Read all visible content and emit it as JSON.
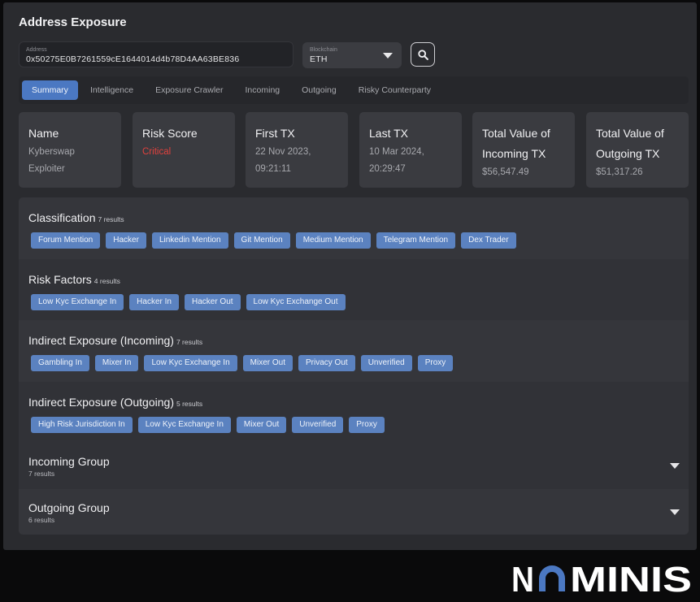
{
  "header": {
    "title": "Address Exposure"
  },
  "address_field": {
    "label": "Address",
    "value": "0x50275E0B7261559cE1644014d4b78D4AA63BE836"
  },
  "blockchain_select": {
    "label": "Blockchain",
    "value": "ETH"
  },
  "tabs": [
    {
      "label": "Summary",
      "active": true
    },
    {
      "label": "Intelligence"
    },
    {
      "label": "Exposure Crawler"
    },
    {
      "label": "Incoming"
    },
    {
      "label": "Outgoing"
    },
    {
      "label": "Risky Counterparty"
    }
  ],
  "cards": {
    "name": {
      "title": "Name",
      "value": "Kyberswap",
      "value2": "Exploiter"
    },
    "risk": {
      "title": "Risk Score",
      "value": "Critical"
    },
    "first": {
      "title": "First TX",
      "value": "22 Nov 2023,",
      "value2": "09:21:11"
    },
    "last": {
      "title": "Last TX",
      "value": "10 Mar 2024,",
      "value2": "20:29:47"
    },
    "incoming": {
      "title": "Total Value of",
      "title2": "Incoming TX",
      "value": "$56,547.49"
    },
    "outgoing": {
      "title": "Total Value of",
      "title2": "Outgoing TX",
      "value": "$51,317.26"
    }
  },
  "sections": {
    "classification": {
      "name": "Classification",
      "count": "7 results",
      "tags": [
        "Forum Mention",
        "Hacker",
        "Linkedin Mention",
        "Git Mention",
        "Medium Mention",
        "Telegram Mention",
        "Dex Trader"
      ]
    },
    "risk_factors": {
      "name": "Risk Factors",
      "count": "4 results",
      "tags": [
        "Low Kyc Exchange In",
        "Hacker In",
        "Hacker Out",
        "Low Kyc Exchange Out"
      ]
    },
    "indirect_in": {
      "name": "Indirect Exposure (Incoming)",
      "count": "7 results",
      "tags": [
        "Gambling In",
        "Mixer In",
        "Low Kyc Exchange In",
        "Mixer Out",
        "Privacy Out",
        "Unverified",
        "Proxy"
      ]
    },
    "indirect_out": {
      "name": "Indirect Exposure (Outgoing)",
      "count": "5 results",
      "tags": [
        "High Risk Jurisdiction In",
        "Low Kyc Exchange In",
        "Mixer Out",
        "Unverified",
        "Proxy"
      ]
    },
    "incoming_group": {
      "name": "Incoming Group",
      "count": "7 results"
    },
    "outgoing_group": {
      "name": "Outgoing Group",
      "count": "6 results"
    }
  },
  "brand": {
    "text": "NOMINIS",
    "accent": "#4b78c2"
  },
  "colors": {
    "critical": "#e0413d",
    "chip": "#5b82c0",
    "active_tab": "#4b78c2"
  },
  "icons": {
    "search": "search-icon",
    "dropdown": "chevron-down-icon"
  }
}
